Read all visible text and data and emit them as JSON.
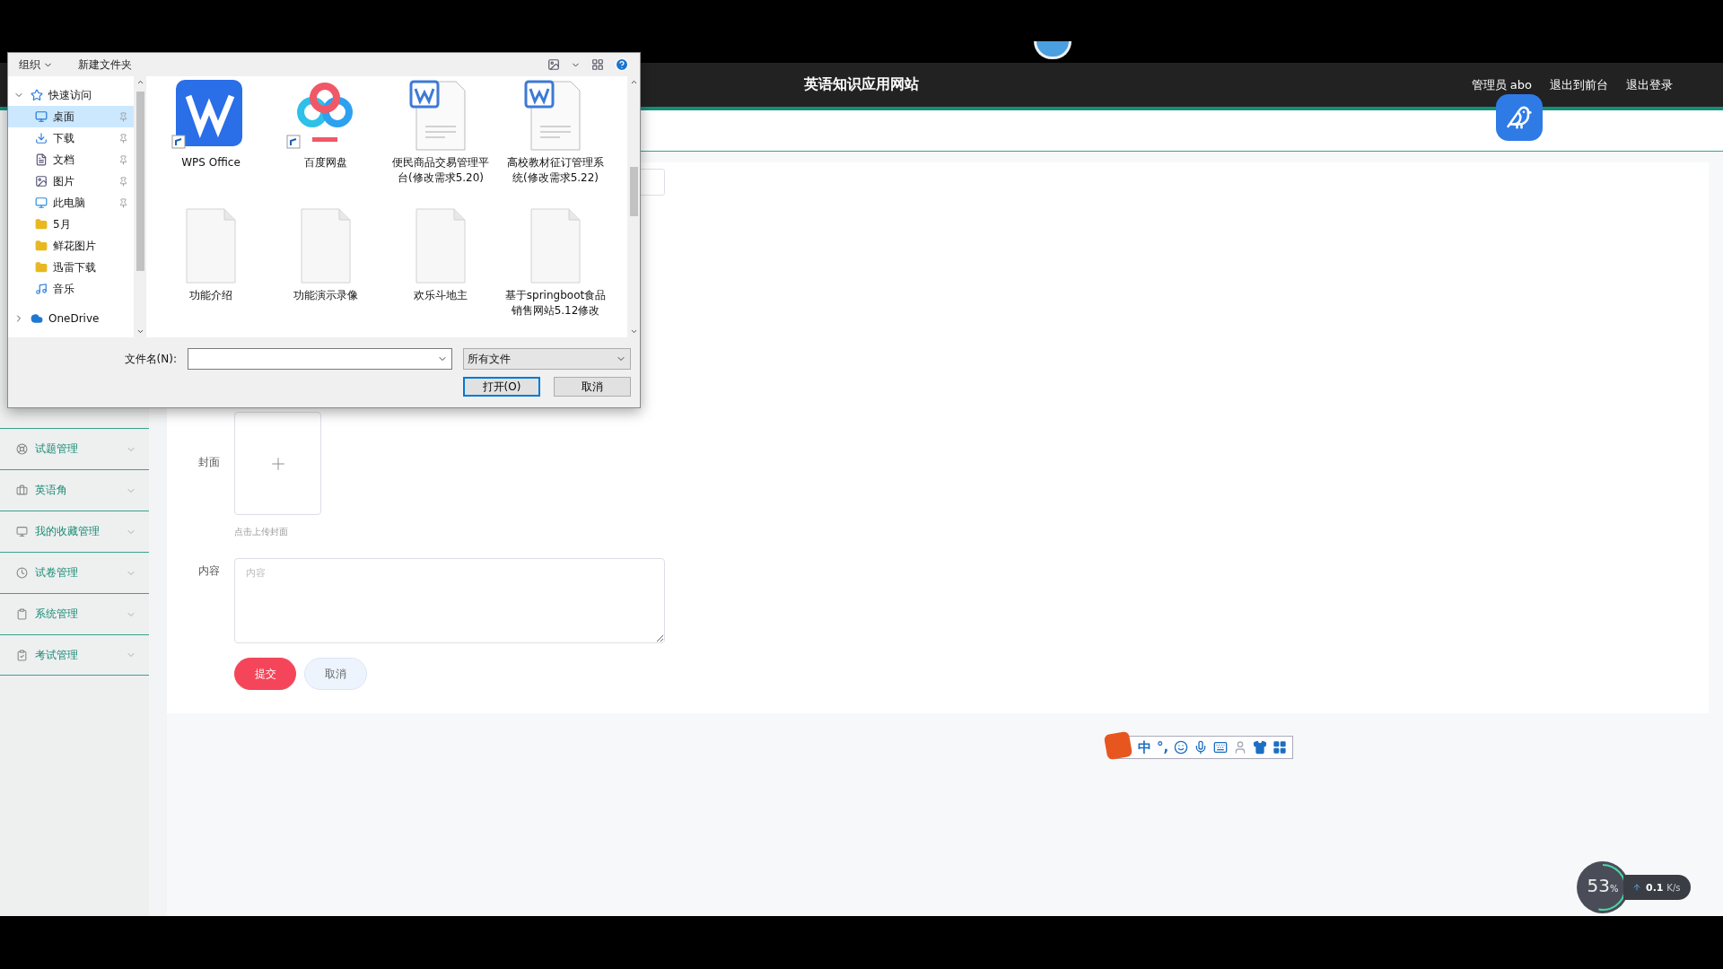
{
  "header": {
    "title": "英语知识应用网站",
    "links": [
      "管理员 abo",
      "退出到前台",
      "退出登录"
    ]
  },
  "sidebar": {
    "items": [
      {
        "label": "试题管理"
      },
      {
        "label": "英语角"
      },
      {
        "label": "我的收藏管理"
      },
      {
        "label": "试卷管理"
      },
      {
        "label": "系统管理"
      },
      {
        "label": "考试管理"
      }
    ]
  },
  "form": {
    "cover_label": "封面",
    "cover_hint": "点击上传封面",
    "content_label": "内容",
    "content_placeholder": "内容",
    "submit": "提交",
    "cancel": "取消"
  },
  "dialog": {
    "toolbar": [
      "组织",
      "新建文件夹"
    ],
    "nav": [
      {
        "label": "快速访问",
        "expanded": true,
        "children": [
          {
            "label": "桌面",
            "pinned": true,
            "selected": true
          },
          {
            "label": "下载",
            "pinned": true,
            "selected": false
          },
          {
            "label": "文档",
            "pinned": true,
            "selected": false
          },
          {
            "label": "图片",
            "pinned": true,
            "selected": false
          },
          {
            "label": "此电脑",
            "pinned": true,
            "selected": false
          },
          {
            "label": "5月",
            "pinned": false,
            "selected": false
          },
          {
            "label": "鲜花图片",
            "pinned": false,
            "selected": false
          },
          {
            "label": "迅雷下载",
            "pinned": false,
            "selected": false
          },
          {
            "label": "音乐",
            "pinned": false,
            "selected": false
          }
        ]
      },
      {
        "label": "OneDrive",
        "expanded": false
      }
    ],
    "files": [
      {
        "kind": "wps",
        "label": "WPS Office"
      },
      {
        "kind": "cloud-app",
        "label": "百度网盘"
      },
      {
        "kind": "word",
        "label": "便民商品交易管理平台(修改需求5.20)"
      },
      {
        "kind": "word",
        "label": "高校教材征订管理系统(修改需求5.22)"
      },
      {
        "kind": "blank",
        "label": "功能介绍"
      },
      {
        "kind": "blank",
        "label": "功能演示录像"
      },
      {
        "kind": "blank",
        "label": "欢乐斗地主"
      },
      {
        "kind": "blank",
        "label": "基于springboot食品销售网站5.12修改"
      }
    ],
    "filename_label": "文件名(N):",
    "filter": "所有文件",
    "open": "打开(O)",
    "cancel": "取消"
  },
  "ime": {
    "mode": "中",
    "punctuation": "°,"
  },
  "monitor": {
    "percent": "53",
    "unit": "%",
    "level": 0.53,
    "speed": "0.1",
    "speed_unit": "K/s"
  }
}
